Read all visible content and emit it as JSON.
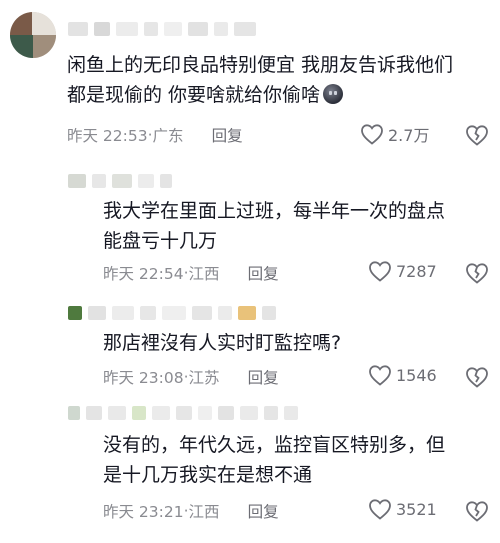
{
  "comments": [
    {
      "lines": [
        "闲鱼上的无印良品特别便宜 我朋友告诉我他们",
        "都是现偷的 你要啥就给你偷啥"
      ],
      "emoji": "dark-face-emoji",
      "time": "昨天 22:53",
      "location": "广东",
      "reply_label": "回复",
      "likes": "2.7万"
    },
    {
      "lines": [
        "我大学在里面上过班，每半年一次的盘点",
        "能盘亏十几万"
      ],
      "time": "昨天 22:54",
      "location": "江西",
      "reply_label": "回复",
      "likes": "7287"
    },
    {
      "lines": [
        "那店裡沒有人实时盯監控嗎?"
      ],
      "time": "昨天 23:08",
      "location": "江苏",
      "reply_label": "回复",
      "likes": "1546"
    },
    {
      "lines": [
        "没有的，年代久远，监控盲区特别多，但",
        "是十几万我实在是想不通"
      ],
      "time": "昨天 23:21",
      "location": "江西",
      "reply_label": "回复",
      "likes": "3521"
    }
  ],
  "separator": "·",
  "icons": {
    "like": "heart-outline-icon",
    "dislike": "broken-heart-icon"
  },
  "colors": {
    "text": "#161823",
    "meta": "#8a8b91",
    "icon": "#6c6d74"
  }
}
